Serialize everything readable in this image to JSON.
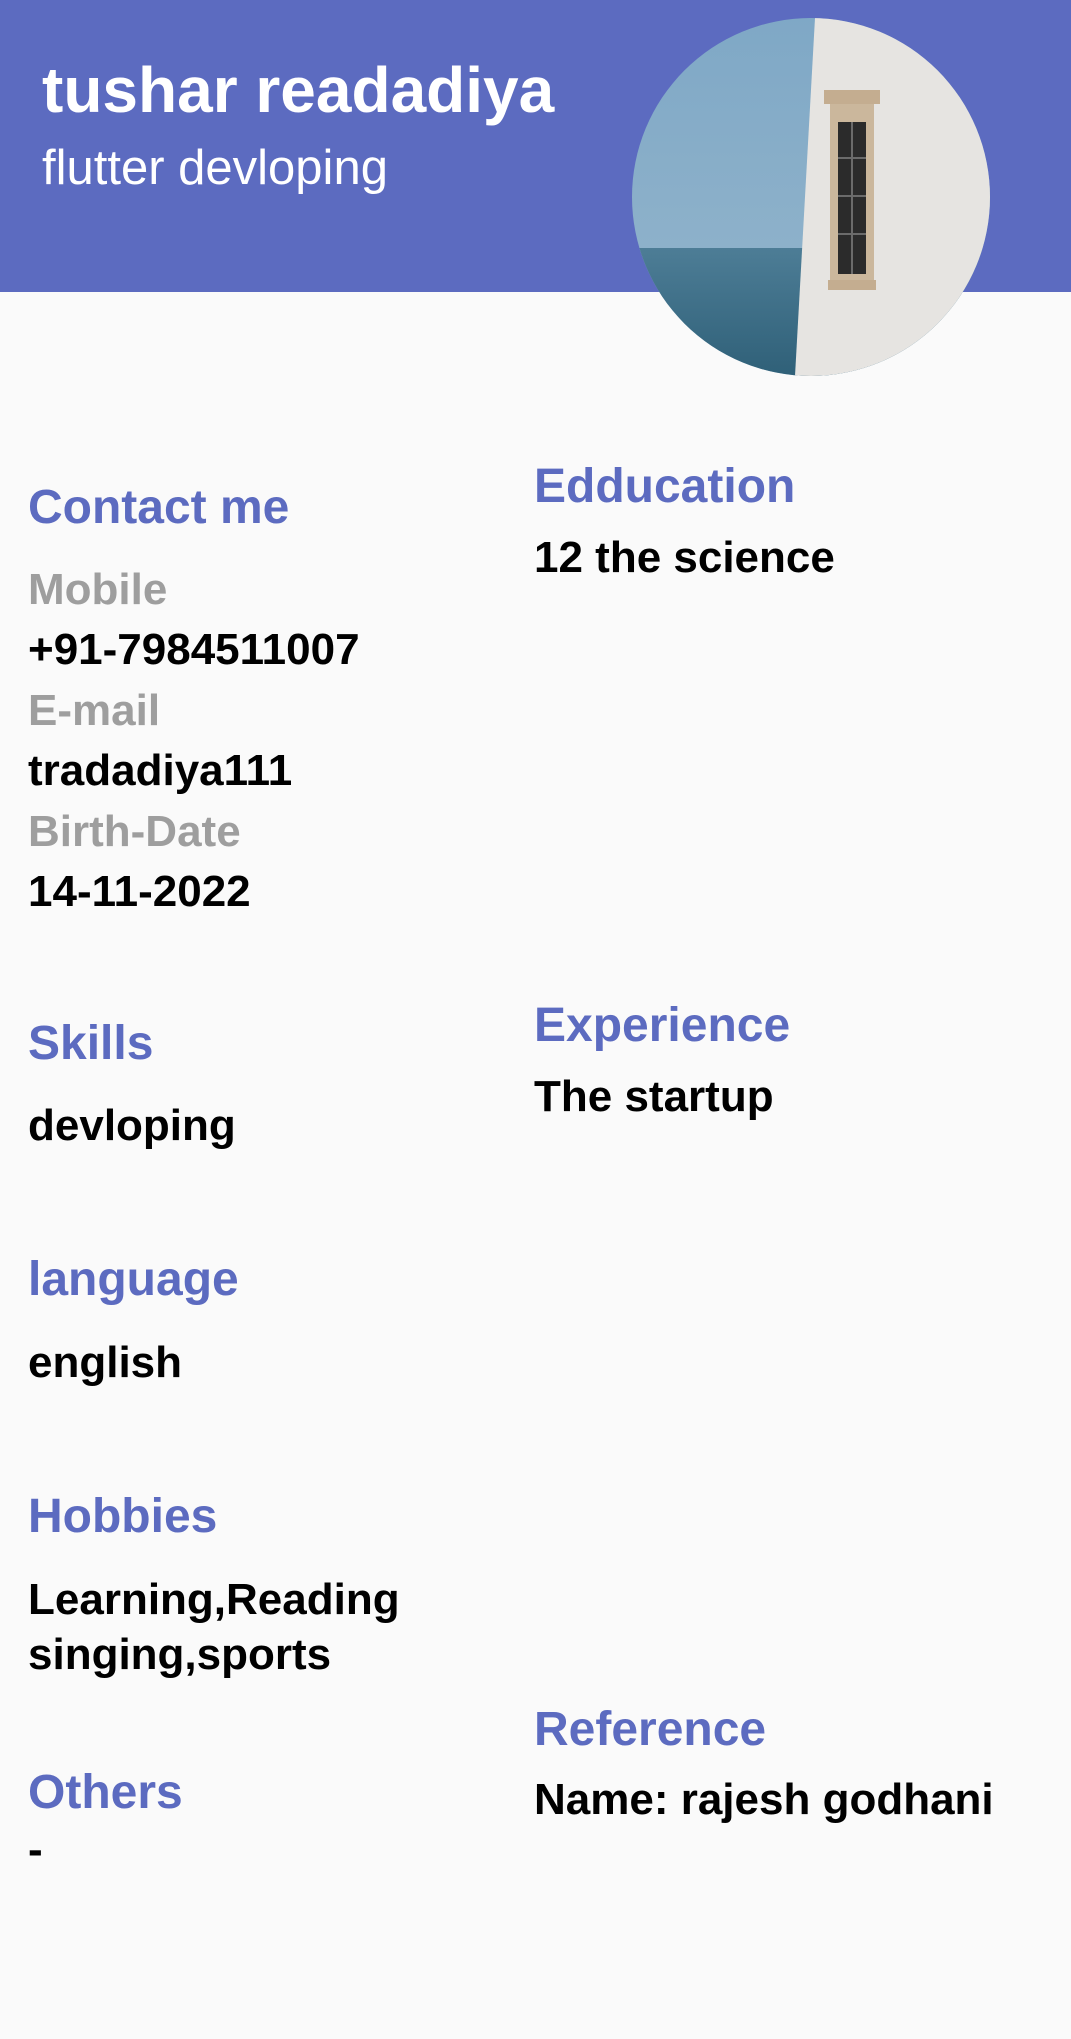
{
  "header": {
    "name": "tushar readadiya",
    "title": "flutter devloping",
    "background_color": "#5c6bc0"
  },
  "avatar": {
    "icon": "profile-photo"
  },
  "contact": {
    "heading": "Contact me",
    "mobile_label": "Mobile",
    "mobile_value": "+91-7984511007",
    "email_label": "E-mail",
    "email_value": "tradadiya111",
    "birth_label": "Birth-Date",
    "birth_value": "14-11-2022"
  },
  "education": {
    "heading": "Edducation",
    "value": "12 the science"
  },
  "skills": {
    "heading": "Skills",
    "value": "devloping"
  },
  "experience": {
    "heading": "Experience",
    "value": "The startup"
  },
  "language": {
    "heading": "language",
    "value": "english"
  },
  "hobbies": {
    "heading": "Hobbies",
    "line1": "Learning,Reading",
    "line2": "singing,sports"
  },
  "reference": {
    "heading": "Reference",
    "value": "Name: rajesh godhani"
  },
  "others": {
    "heading": "Others",
    "value": "-"
  },
  "colors": {
    "accent": "#5c6bc0",
    "label": "#9e9e9e",
    "text": "#000000",
    "background": "#fafafa"
  }
}
